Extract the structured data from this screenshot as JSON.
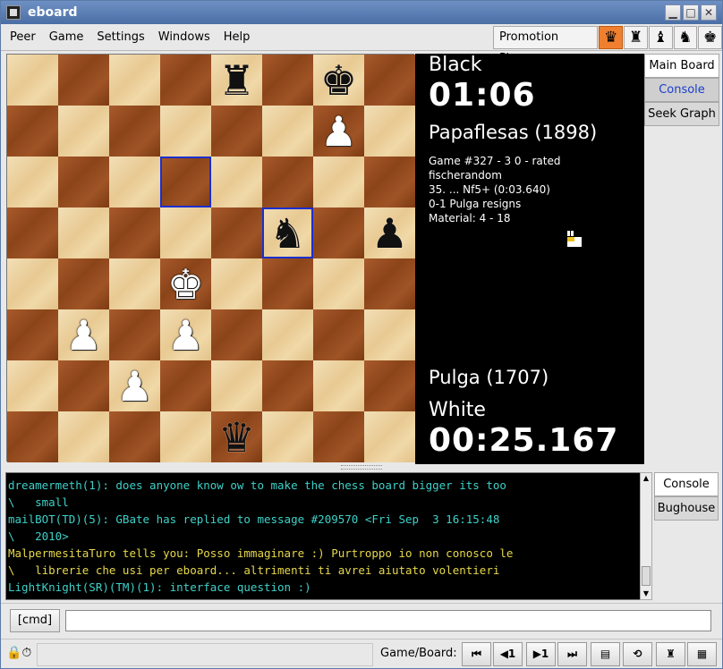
{
  "window": {
    "title": "eboard",
    "minimize_icon": "minimize-icon",
    "maximize_icon": "maximize-icon",
    "close_icon": "close-icon"
  },
  "menu": [
    "Peer",
    "Game",
    "Settings",
    "Windows",
    "Help"
  ],
  "promotion": {
    "label": "Promotion Piece",
    "pieces": [
      "♛",
      "♜",
      "♝",
      "♞",
      "♚"
    ],
    "selected": 0
  },
  "board": {
    "rows": [
      [
        "",
        "",
        "",
        "",
        "bR",
        "",
        "bK",
        ""
      ],
      [
        "",
        "",
        "",
        "",
        "",
        "",
        "wP",
        ""
      ],
      [
        "",
        "",
        "",
        "",
        "",
        "",
        "",
        ""
      ],
      [
        "",
        "",
        "",
        "",
        "",
        "bN",
        "",
        "bP"
      ],
      [
        "",
        "",
        "",
        "wK",
        "",
        "",
        "",
        ""
      ],
      [
        "",
        "wP",
        "",
        "wP",
        "",
        "",
        "",
        ""
      ],
      [
        "",
        "",
        "wP",
        "",
        "",
        "",
        "",
        ""
      ],
      [
        "",
        "",
        "",
        "",
        "bQ",
        "",
        "",
        ""
      ]
    ],
    "highlights": [
      [
        2,
        3
      ],
      [
        3,
        5
      ]
    ]
  },
  "info": {
    "black_label": "Black",
    "black_clock": "01:06",
    "black_player": "Papaflesas (1898)",
    "game_lines": [
      "Game #327 - 3 0 - rated",
      "fischerandom",
      "35. ... Nf5+ (0:03.640)",
      "0-1 Pulga resigns",
      "Material: 4 - 18"
    ],
    "white_player": "Pulga (1707)",
    "white_label": "White",
    "white_clock": "00:25.167"
  },
  "side_tabs": [
    "Main Board",
    "Console",
    "Seek Graph"
  ],
  "console": {
    "lines": [
      {
        "color": "cyan",
        "text": "dreamermeth(1): does anyone know ow to make the chess board bigger its too"
      },
      {
        "color": "cyan",
        "text": "\\   small"
      },
      {
        "color": "cyan",
        "text": "mailBOT(TD)(5): GBate has replied to message #209570 <Fri Sep  3 16:15:48"
      },
      {
        "color": "cyan",
        "text": "\\   2010>"
      },
      {
        "color": "yellow",
        "text": "MalpermesitaTuro tells you: Posso immaginare :) Purtroppo io non conosco le"
      },
      {
        "color": "yellow",
        "text": "\\   librerie che usi per eboard... altrimenti ti avrei aiutato volentieri"
      },
      {
        "color": "cyan",
        "text": "LightKnight(SR)(TM)(1): interface question :)"
      }
    ],
    "tabs": [
      "Console",
      "Bughouse"
    ]
  },
  "cmd": {
    "button": "[cmd]",
    "value": ""
  },
  "status": {
    "game_board_label": "Game/Board:",
    "nav": [
      "⏮",
      "◀1",
      "▶1",
      "⏭"
    ],
    "tool_icons": [
      "notation-icon",
      "flip-icon",
      "sound-icon",
      "board-icon"
    ]
  }
}
